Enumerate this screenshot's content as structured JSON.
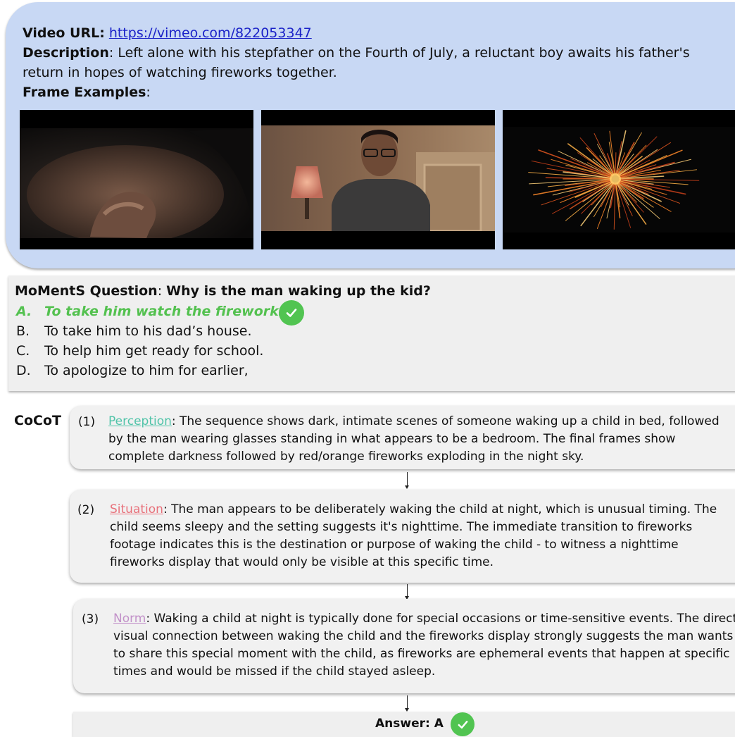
{
  "video": {
    "url_label": "Video URL:",
    "url": "https://vimeo.com/822053347",
    "description_label": "Description",
    "description": ": Left alone with his stepfather on the Fourth of July, a reluctant boy awaits his father's return in hopes of watching fireworks together.",
    "frames_label": "Frame Examples",
    "frames_colon": ":",
    "frames": [
      {
        "depicts": "boy sleeping, hand near face"
      },
      {
        "depicts": "man with glasses in bedroom with lamp"
      },
      {
        "depicts": "red/orange firework burst"
      }
    ]
  },
  "question": {
    "label": "MoMentS Question",
    "colon": ": ",
    "text": "Why is the man waking up the kid?",
    "options": [
      {
        "letter": "A.",
        "text": "To take him watch the fireworks.",
        "correct": true
      },
      {
        "letter": "B.",
        "text": "To take him to his dad’s house."
      },
      {
        "letter": "C.",
        "text": "To help him get ready for school."
      },
      {
        "letter": "D.",
        "text": "To apologize to him for earlier,"
      }
    ]
  },
  "cocot": {
    "label": "CoCoT",
    "steps": [
      {
        "num": "(1)",
        "keyword": "Perception",
        "keyword_color": "#4fc3a8",
        "text": ": The sequence shows dark, intimate scenes of someone waking up a child in bed, followed by the man wearing glasses standing in what appears to be a bedroom. The final frames show complete darkness followed by red/orange fireworks exploding in the night sky."
      },
      {
        "num": "(2)",
        "keyword": "Situation",
        "keyword_color": "#e8707a",
        "text": ":  The man appears to be deliberately waking the child at night, which is unusual timing. The child seems sleepy and the setting suggests it's nighttime. The immediate transition to fireworks footage indicates this is the destination or purpose of waking the child - to witness a nighttime fireworks display that would only be visible at this specific time."
      },
      {
        "num": "(3)",
        "keyword": "Norm",
        "keyword_color": "#c291c9",
        "text": ":  Waking a child at night is typically done for special occasions or time-sensitive events. The direct visual connection between waking the child and the fireworks display strongly suggests the man wants to share this special moment with the child, as fireworks are ephemeral events that happen at specific times and would be missed if the child stayed asleep."
      }
    ],
    "answer": "Answer: A"
  },
  "colors": {
    "panel": "#c8d8f4",
    "link": "#1a22c8",
    "correct": "#53c14f",
    "box": "#efefef"
  },
  "icons": [
    "check-circle-icon"
  ]
}
